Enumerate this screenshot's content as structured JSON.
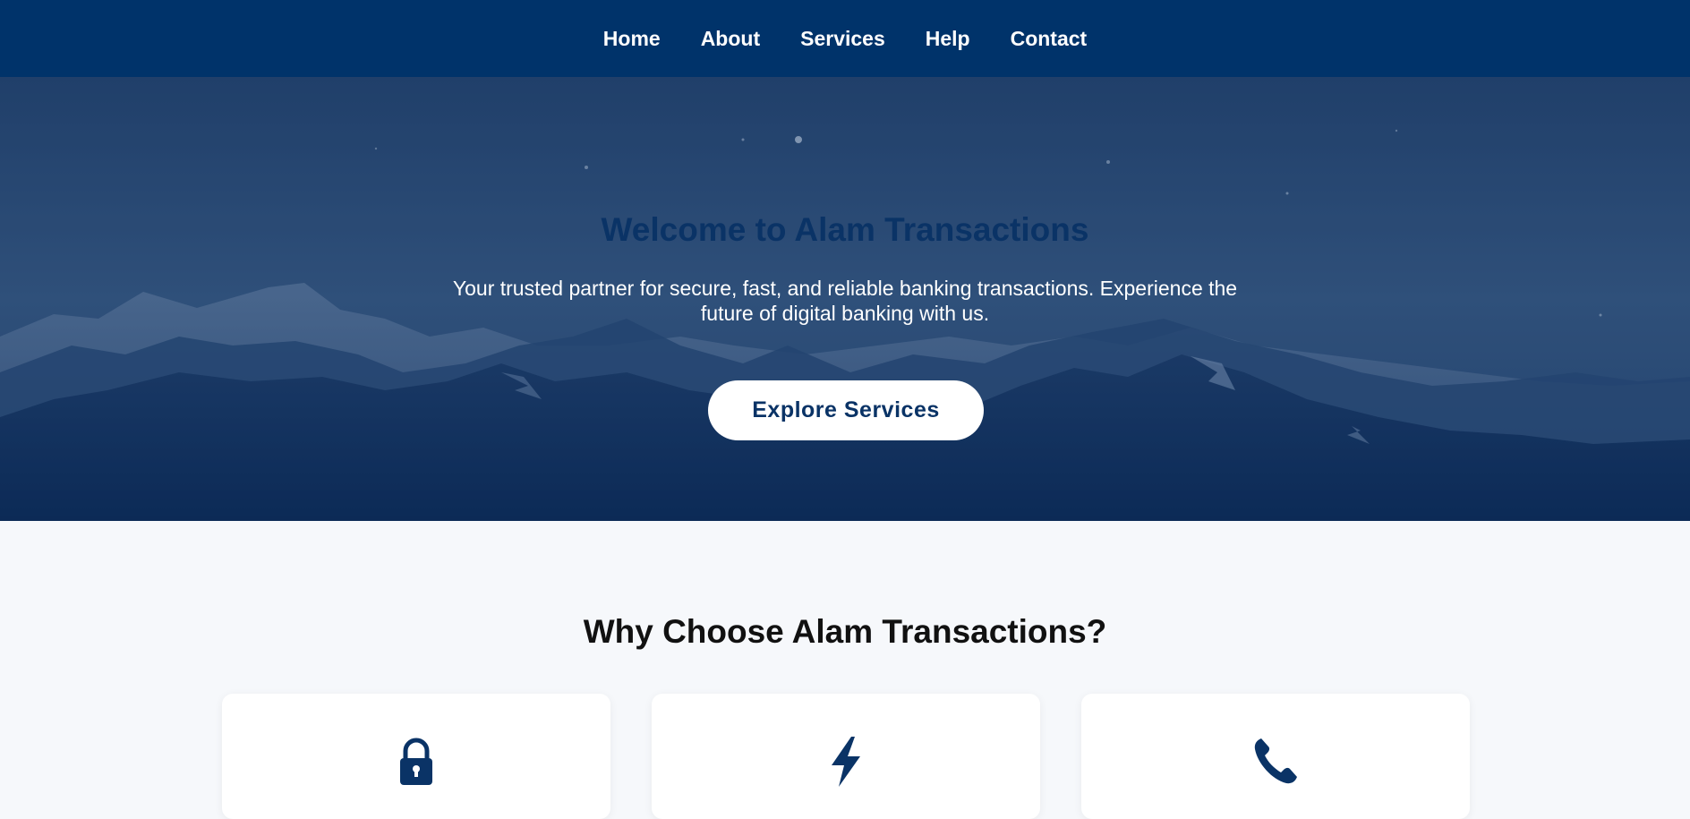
{
  "nav": {
    "items": [
      {
        "label": "Home"
      },
      {
        "label": "About"
      },
      {
        "label": "Services"
      },
      {
        "label": "Help"
      },
      {
        "label": "Contact"
      }
    ]
  },
  "hero": {
    "title": "Welcome to Alam Transactions",
    "subtitle": "Your trusted partner for secure, fast, and reliable banking transactions. Experience the future of digital banking with us.",
    "cta_label": "Explore Services"
  },
  "features": {
    "heading": "Why Choose Alam Transactions?",
    "cards": [
      {
        "icon": "lock-icon"
      },
      {
        "icon": "lightning-icon"
      },
      {
        "icon": "phone-icon"
      }
    ]
  },
  "colors": {
    "nav_bg": "#00336a",
    "accent": "#0a3366",
    "page_bg": "#f6f8fb"
  }
}
